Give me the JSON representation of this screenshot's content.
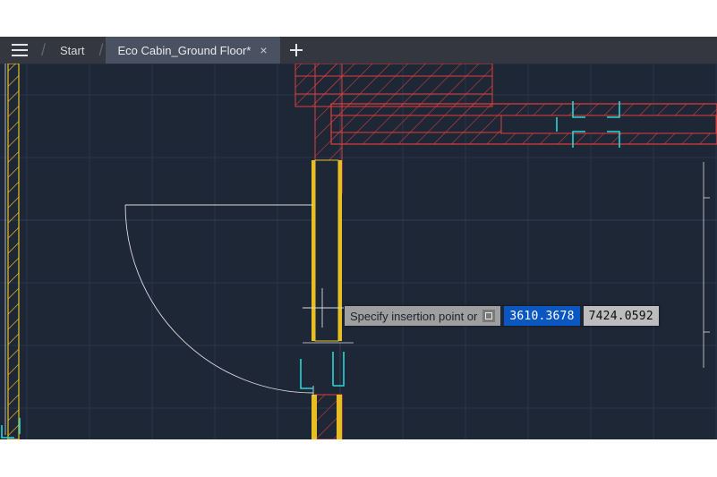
{
  "tabs": {
    "start_label": "Start",
    "active_label": "Eco Cabin_Ground Floor*",
    "close_glyph": "×"
  },
  "dynamic_input": {
    "prompt": "Specify insertion point or",
    "x_value": "3610.3678",
    "y_value": "7424.0592"
  },
  "colors": {
    "bg": "#1e2736",
    "grid_minor": "#28344a",
    "grid_major": "#303e58",
    "wall_red": "#e03d3a",
    "wall_yellow": "#e8bf23",
    "fixture_cyan": "#2ad6d6",
    "guide_white": "#d8dce2",
    "hatch": "#e03d3a"
  }
}
